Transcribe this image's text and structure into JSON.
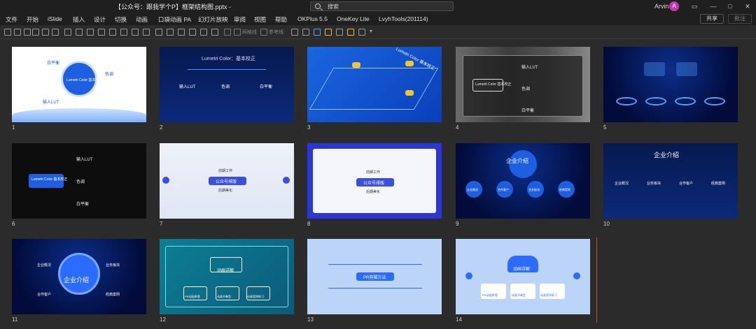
{
  "window": {
    "title": "【公众号：跟我学个P】框架结构图.pptx  -",
    "search_placeholder": "搜索",
    "user_name": "Arvin",
    "avatar_initial": "A",
    "controls": [
      "restore-icon",
      "minimize-icon",
      "maximize-icon",
      "close-icon"
    ]
  },
  "menu": {
    "items": [
      "文件",
      "开始",
      "iSlide",
      "插入",
      "设计",
      "切换",
      "动画",
      "口袋动画 PA",
      "幻灯片放映",
      "审阅",
      "视图",
      "帮助",
      "OKPlus 5.5",
      "OneKey Lite",
      "LvyhTools(201114)"
    ],
    "share_label": "共享",
    "comment_label": "批注"
  },
  "toolbar": {
    "grid_label": "网格线",
    "guides_label": "参考线"
  },
  "slides": [
    {
      "num": "1",
      "title": "Lumetri Color 基本校正",
      "labels": [
        "白平衡",
        "色调",
        "输入LUT"
      ]
    },
    {
      "num": "2",
      "title": "Lumetri Color：基本校正",
      "labels": [
        "输入LUT",
        "色调",
        "白平衡"
      ]
    },
    {
      "num": "3",
      "title": "Lumetri Color 基本校正",
      "labels": []
    },
    {
      "num": "4",
      "title": "Lumetri Color 基本校正",
      "labels": [
        "输入LUT",
        "色调",
        "白平衡"
      ]
    },
    {
      "num": "5",
      "title": "",
      "labels": []
    },
    {
      "num": "6",
      "title": "Lumetri Color 基本校正",
      "labels": [
        "输入LUT",
        "色调",
        "白平衡"
      ]
    },
    {
      "num": "7",
      "title": "公众号排版",
      "labels": [
        "前期工作",
        "后期美化"
      ]
    },
    {
      "num": "8",
      "title": "公众号排版",
      "labels": [
        "前期工作",
        "后期美化"
      ]
    },
    {
      "num": "9",
      "title": "企业介绍",
      "labels": [
        "企业概况",
        "合作客户",
        "业务板块",
        "经典案例"
      ]
    },
    {
      "num": "10",
      "title": "企业介绍",
      "labels": [
        "企业概况",
        "业务板块",
        "合作客户",
        "经典案例"
      ]
    },
    {
      "num": "11",
      "title": "企业介绍",
      "labels": [
        "企业概况",
        "业务板块",
        "合作客户",
        "经典案例"
      ]
    },
    {
      "num": "12",
      "title": "动画详解",
      "labels": [
        "PR动画原理",
        "动画节奏型",
        "动画案例练习"
      ]
    },
    {
      "num": "13",
      "title": "PR剪辑方法",
      "labels": []
    },
    {
      "num": "14",
      "title": "动画详解",
      "labels": [
        "PR动画原理",
        "动画节奏型",
        "动画案例练习"
      ]
    }
  ],
  "colors": {
    "accent": "#c239b3",
    "titlebar": "#1f1f1f",
    "workspace": "#2b2b2b"
  }
}
